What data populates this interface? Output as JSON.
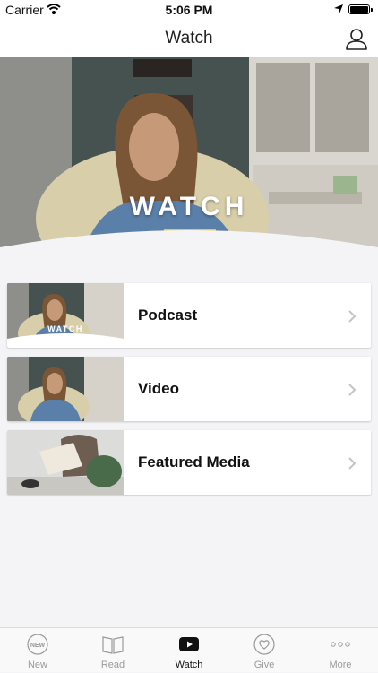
{
  "status_bar": {
    "carrier": "Carrier",
    "time": "5:06 PM"
  },
  "nav": {
    "title": "Watch",
    "profile_icon": "person-icon"
  },
  "hero": {
    "title": "WATCH",
    "accent_color": "#f3c623"
  },
  "items": [
    {
      "label": "Podcast",
      "thumb_overlay": "WATCH"
    },
    {
      "label": "Video"
    },
    {
      "label": "Featured Media"
    }
  ],
  "tabs": [
    {
      "label": "New",
      "icon": "new-badge-icon",
      "badge": "NEW"
    },
    {
      "label": "Read",
      "icon": "book-icon"
    },
    {
      "label": "Watch",
      "icon": "play-icon",
      "active": true
    },
    {
      "label": "Give",
      "icon": "heart-icon"
    },
    {
      "label": "More",
      "icon": "more-dots-icon"
    }
  ]
}
